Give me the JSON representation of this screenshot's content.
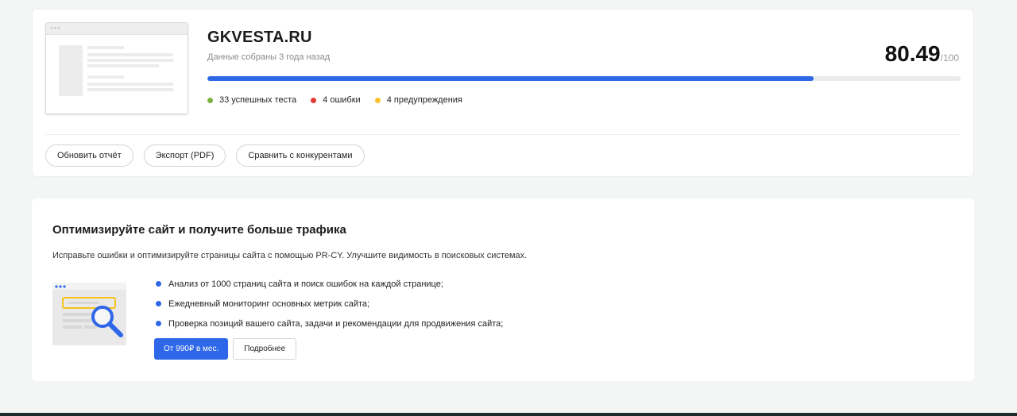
{
  "report": {
    "site": "GKVESTA.RU",
    "collected": "Данные собраны 3 года назад",
    "score": "80.49",
    "score_max": "/100",
    "progress_fraction": 0.8049,
    "stats": [
      {
        "label": "33 успешных теста",
        "color": "#7cb342"
      },
      {
        "label": "4 ошибки",
        "color": "#e53935"
      },
      {
        "label": "4 предупреждения",
        "color": "#fbc02d"
      }
    ],
    "actions": {
      "refresh": "Обновить отчёт",
      "export": "Экспорт (PDF)",
      "compare": "Сравнить с конкурентами"
    }
  },
  "promo": {
    "title": "Оптимизируйте сайт и получите больше трафика",
    "subtitle": "Исправьте ошибки и оптимизируйте страницы сайта с помощью PR-CY. Улучшите видимость в поисковых системах.",
    "features": [
      "Анализ от 1000 страниц сайта и поиск ошибок на каждой странице;",
      "Ежедневный мониторинг основных метрик сайта;",
      "Проверка позиций вашего сайта, задачи и рекомендации для продвижения сайта;"
    ],
    "price_button": "От 990₽ в мес.",
    "more_button": "Подробнее",
    "illustration_icon": "magnifier-search-icon"
  },
  "colors": {
    "accent": "#2e67e8",
    "success": "#7cb342",
    "error": "#e53935",
    "warning": "#fbc02d"
  }
}
